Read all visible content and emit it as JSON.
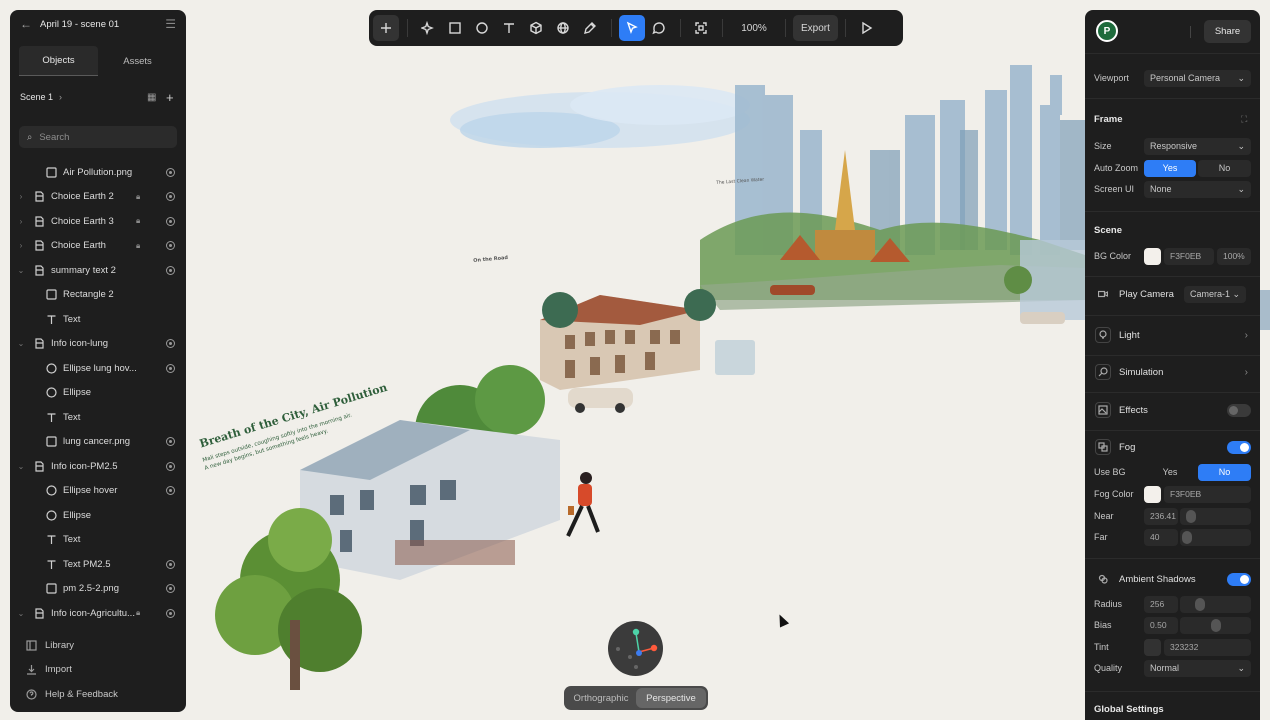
{
  "project": {
    "title": "April 19 - scene 01"
  },
  "left_tabs": [
    "Objects",
    "Assets"
  ],
  "scene_selector": "Scene 1",
  "search_placeholder": "Search",
  "layers": [
    {
      "name": "Air Pollution.png",
      "icon": "image-icon",
      "depth": 1,
      "caret": "",
      "lock": false,
      "eye": true
    },
    {
      "name": "Choice Earth 2",
      "icon": "component-icon",
      "depth": 0,
      "caret": "›",
      "lock": true,
      "eye": true
    },
    {
      "name": "Choice Earth 3",
      "icon": "component-icon",
      "depth": 0,
      "caret": "›",
      "lock": true,
      "eye": true
    },
    {
      "name": "Choice Earth",
      "icon": "component-icon",
      "depth": 0,
      "caret": "›",
      "lock": true,
      "eye": true
    },
    {
      "name": "summary text 2",
      "icon": "component-icon",
      "depth": 0,
      "caret": "⌄",
      "lock": false,
      "eye": true
    },
    {
      "name": "Rectangle 2",
      "icon": "rect-icon",
      "depth": 1,
      "caret": "",
      "lock": false,
      "eye": false
    },
    {
      "name": "Text",
      "icon": "text-icon",
      "depth": 1,
      "caret": "",
      "lock": false,
      "eye": false
    },
    {
      "name": "Info icon-lung",
      "icon": "component-icon",
      "depth": 0,
      "caret": "⌄",
      "lock": false,
      "eye": true
    },
    {
      "name": "Ellipse lung hov...",
      "icon": "ellipse-icon",
      "depth": 1,
      "caret": "",
      "lock": false,
      "eye": true
    },
    {
      "name": "Ellipse",
      "icon": "ellipse-icon",
      "depth": 1,
      "caret": "",
      "lock": false,
      "eye": false
    },
    {
      "name": "Text",
      "icon": "text-icon",
      "depth": 1,
      "caret": "",
      "lock": false,
      "eye": false
    },
    {
      "name": "lung cancer.png",
      "icon": "image-icon",
      "depth": 1,
      "caret": "",
      "lock": false,
      "eye": true
    },
    {
      "name": "Info icon-PM2.5",
      "icon": "component-icon",
      "depth": 0,
      "caret": "⌄",
      "lock": false,
      "eye": true
    },
    {
      "name": "Ellipse hover",
      "icon": "ellipse-icon",
      "depth": 1,
      "caret": "",
      "lock": false,
      "eye": true
    },
    {
      "name": "Ellipse",
      "icon": "ellipse-icon",
      "depth": 1,
      "caret": "",
      "lock": false,
      "eye": false
    },
    {
      "name": "Text",
      "icon": "text-icon",
      "depth": 1,
      "caret": "",
      "lock": false,
      "eye": false
    },
    {
      "name": "Text PM2.5",
      "icon": "text-icon",
      "depth": 1,
      "caret": "",
      "lock": false,
      "eye": true
    },
    {
      "name": "pm 2.5-2.png",
      "icon": "image-icon",
      "depth": 1,
      "caret": "",
      "lock": false,
      "eye": true
    },
    {
      "name": "Info icon-Agricultu...",
      "icon": "component-icon",
      "depth": 0,
      "caret": "⌄",
      "lock": true,
      "eye": true
    }
  ],
  "left_footer": [
    {
      "label": "Library",
      "icon": "library-icon"
    },
    {
      "label": "Import",
      "icon": "import-icon"
    },
    {
      "label": "Help & Feedback",
      "icon": "help-icon"
    }
  ],
  "toolbar": {
    "zoom": "100%",
    "export": "Export"
  },
  "right": {
    "share": "Share",
    "avatar": "P",
    "viewport_label": "Viewport",
    "viewport_value": "Personal Camera",
    "frame_title": "Frame",
    "size_label": "Size",
    "size_value": "Responsive",
    "autozoom_label": "Auto Zoom",
    "yes": "Yes",
    "no": "No",
    "screenui_label": "Screen UI",
    "screenui_value": "None",
    "scene_title": "Scene",
    "bgcolor_label": "BG Color",
    "bgcolor_hex": "F3F0EB",
    "bgcolor_opacity": "100%",
    "play_camera": "Play Camera",
    "camera_value": "Camera-1",
    "light": "Light",
    "simulation": "Simulation",
    "effects": "Effects",
    "fog": "Fog",
    "usebg_label": "Use BG",
    "fogcolor_label": "Fog Color",
    "fogcolor_hex": "F3F0EB",
    "near_label": "Near",
    "near_value": "236.41",
    "far_label": "Far",
    "far_value": "40",
    "ambient": "Ambient Shadows",
    "radius_label": "Radius",
    "radius_value": "256",
    "bias_label": "Bias",
    "bias_value": "0.50",
    "tint_label": "Tint",
    "tint_hex": "323232",
    "quality_label": "Quality",
    "quality_value": "Normal",
    "global_settings": "Global Settings"
  },
  "projection": {
    "ortho": "Orthographic",
    "persp": "Perspective"
  },
  "scene_labels": {
    "main": "Breath of the City, Air Pollution",
    "sub1": "Mali steps outside, coughing softly into the morning air.",
    "sub2": "A new day begins, but something feels heavy.",
    "road": "On the Road",
    "clean": "The Last Clean Water"
  },
  "colors": {
    "accent": "#2e7df6",
    "panel": "#1e1e1e",
    "canvas": "#f1efea"
  }
}
